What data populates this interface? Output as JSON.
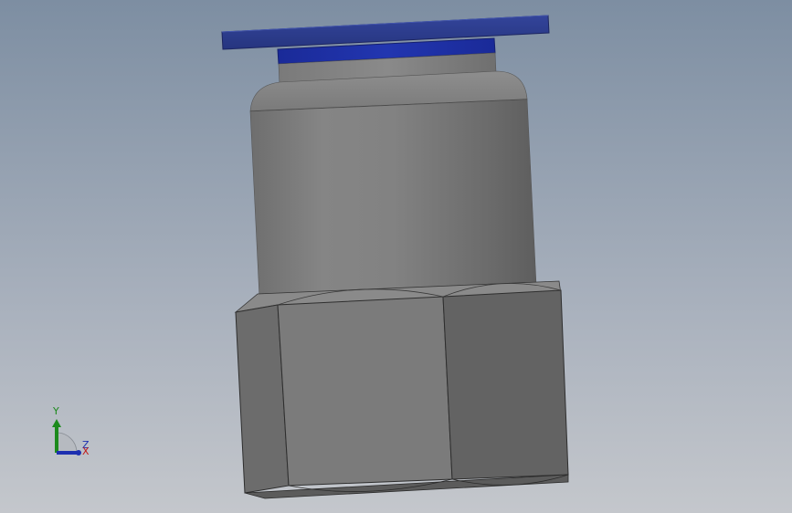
{
  "viewport": {
    "name": "3d-model-viewport"
  },
  "triad": {
    "y_label": "Y",
    "x_label": "X",
    "z_label": "Z",
    "colors": {
      "y": "#1c8a1c",
      "x": "#c21818",
      "z": "#1c2fb0"
    }
  },
  "model": {
    "colors": {
      "cap": "#2b3b8f",
      "collar": "#1d2fa6",
      "body": "#7f7f7f",
      "nut": "#767676"
    }
  }
}
